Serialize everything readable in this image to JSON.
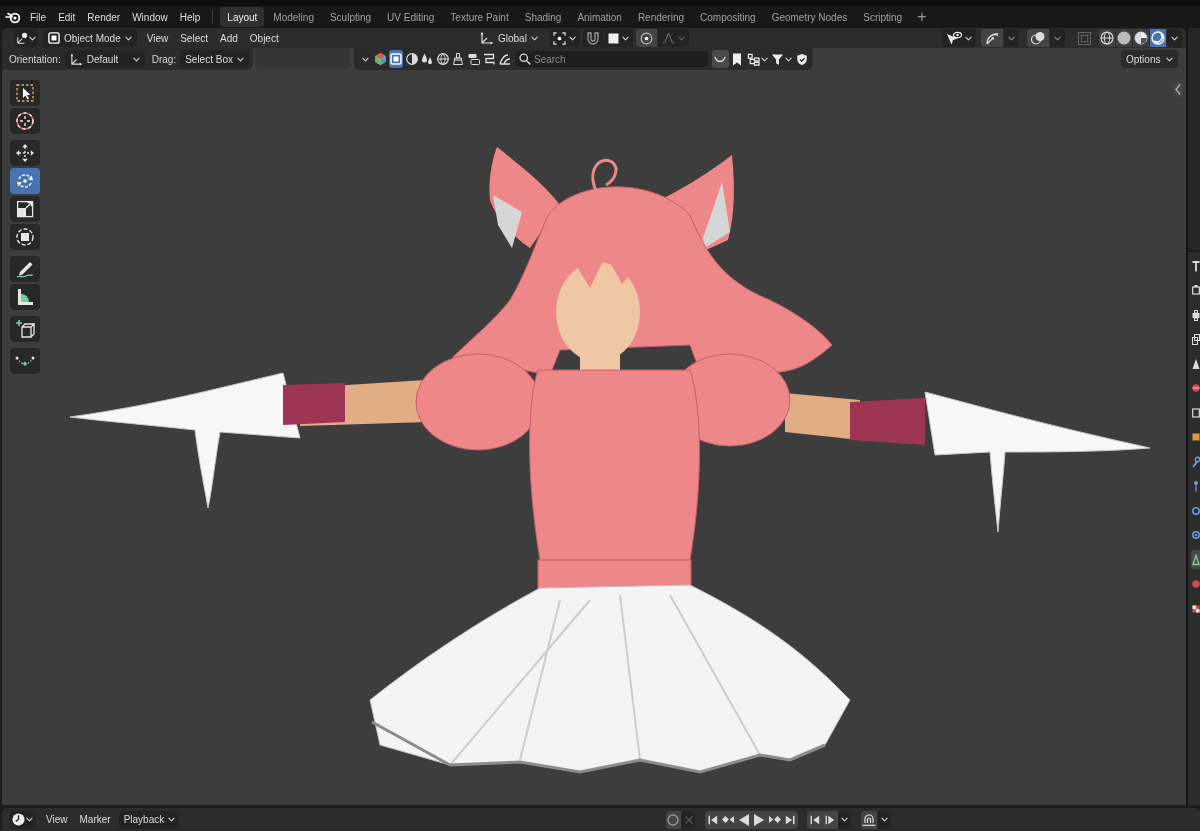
{
  "menu_bar": [
    "File",
    "Edit",
    "Render",
    "Window",
    "Help"
  ],
  "workspaces": [
    {
      "label": "Layout",
      "selected": true
    },
    {
      "label": "Modeling",
      "selected": false
    },
    {
      "label": "Sculpting",
      "selected": false
    },
    {
      "label": "UV Editing",
      "selected": false
    },
    {
      "label": "Texture Paint",
      "selected": false
    },
    {
      "label": "Shading",
      "selected": false
    },
    {
      "label": "Animation",
      "selected": false
    },
    {
      "label": "Rendering",
      "selected": false
    },
    {
      "label": "Compositing",
      "selected": false
    },
    {
      "label": "Geometry Nodes",
      "selected": false
    },
    {
      "label": "Scripting",
      "selected": false
    }
  ],
  "add_workspace": "+",
  "viewport_header": {
    "mode": "Object Mode",
    "menus": [
      "View",
      "Select",
      "Add",
      "Object"
    ],
    "transform_orientation": "Global",
    "shading_modes": [
      {
        "kind": "wireframe",
        "selected": false
      },
      {
        "kind": "solid",
        "selected": false
      },
      {
        "kind": "material",
        "selected": false
      },
      {
        "kind": "rendered",
        "selected": true
      }
    ]
  },
  "tool_settings": {
    "orientation_label": "Orientation:",
    "orientation": "Default",
    "drag_label": "Drag:",
    "drag": "Select Box",
    "filters": [
      {
        "kind": "square",
        "selected": true
      },
      {
        "kind": "half_circle",
        "selected": false
      },
      {
        "kind": "drops",
        "selected": false
      },
      {
        "kind": "globe",
        "selected": false
      },
      {
        "kind": "brush",
        "selected": false
      },
      {
        "kind": "stack",
        "selected": false
      },
      {
        "kind": "zigzag",
        "selected": false
      },
      {
        "kind": "splash",
        "selected": false
      }
    ],
    "search": {
      "placeholder": "Search"
    },
    "options": "Options"
  },
  "toolbar": [
    {
      "tools": [
        {
          "kind": "select_box",
          "selected": false
        },
        {
          "kind": "cursor",
          "selected": false
        }
      ]
    },
    {
      "tools": [
        {
          "kind": "move",
          "selected": false
        },
        {
          "kind": "rotate",
          "selected": true
        },
        {
          "kind": "scale",
          "selected": false
        },
        {
          "kind": "transform",
          "selected": false
        }
      ]
    },
    {
      "tools": [
        {
          "kind": "annotate",
          "selected": false
        },
        {
          "kind": "measure",
          "selected": false
        }
      ]
    },
    {
      "tools": [
        {
          "kind": "add_cube",
          "selected": false
        }
      ]
    },
    {
      "tools": [
        {
          "kind": "curve",
          "selected": false
        }
      ]
    }
  ],
  "properties_tabs": [
    {
      "kind": "tool",
      "selected": false
    },
    {
      "kind": "render",
      "selected": false
    },
    {
      "kind": "output",
      "selected": false
    },
    {
      "kind": "view_layer",
      "selected": false
    },
    {
      "kind": "scene",
      "selected": false
    },
    {
      "kind": "world",
      "selected": false
    },
    {
      "kind": "collection",
      "selected": false
    },
    {
      "kind": "object",
      "selected": false
    },
    {
      "kind": "modifiers",
      "selected": false
    },
    {
      "kind": "particles",
      "selected": false
    },
    {
      "kind": "physics",
      "selected": false
    },
    {
      "kind": "constraints",
      "selected": false
    },
    {
      "kind": "data",
      "selected": true
    },
    {
      "kind": "material",
      "selected": false
    },
    {
      "kind": "texture",
      "selected": false
    }
  ],
  "timeline": {
    "menus": [
      "View",
      "Marker"
    ],
    "playback": "Playback"
  }
}
